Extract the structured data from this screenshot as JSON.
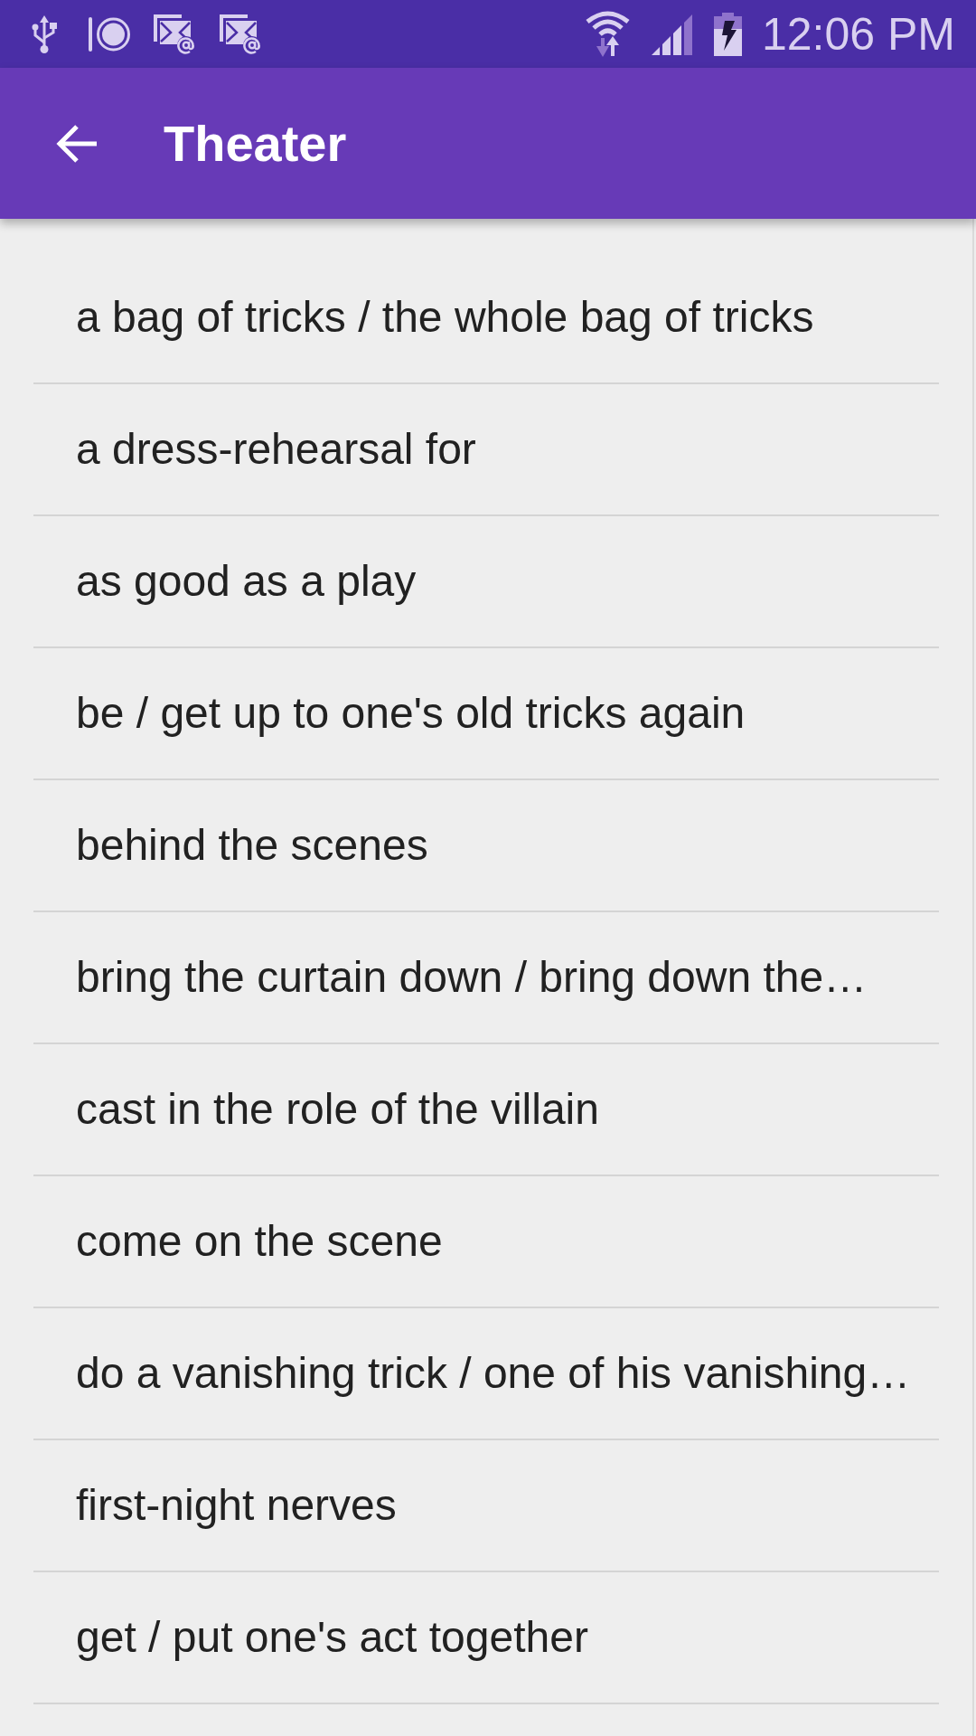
{
  "status_bar": {
    "time": "12:06 PM"
  },
  "app_bar": {
    "title": "Theater"
  },
  "items": [
    "a bag of tricks / the whole bag of tricks",
    "a dress-rehearsal for",
    "as good as a play",
    "be / get up to one's old tricks again",
    "behind the scenes",
    "bring the curtain down / bring down the…",
    "cast in the role of the villain",
    "come on the scene",
    "do a vanishing trick / one of his vanishing…",
    "first-night nerves",
    "get / put one's act together"
  ]
}
